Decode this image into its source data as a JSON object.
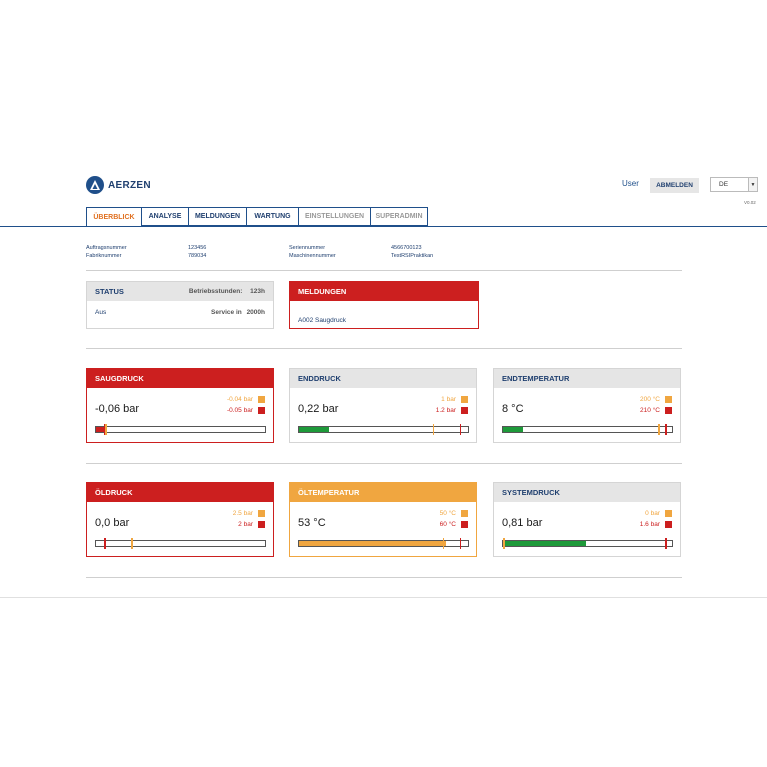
{
  "header": {
    "brand": "AERZEN",
    "user_label": "User",
    "logout_label": "ABMELDEN",
    "language": "DE",
    "version": "V0.02"
  },
  "tabs": [
    {
      "label": "ÜBERBLICK",
      "state": "active"
    },
    {
      "label": "ANALYSE",
      "state": "normal"
    },
    {
      "label": "MELDUNGEN",
      "state": "normal"
    },
    {
      "label": "WARTUNG",
      "state": "normal"
    },
    {
      "label": "EINSTELLUNGEN",
      "state": "disabled"
    },
    {
      "label": "SUPERADMIN",
      "state": "disabled"
    }
  ],
  "info": {
    "auftragsnummer_label": "Auftragsnummer",
    "auftragsnummer_value": "123456",
    "fabriknummer_label": "Fabriknummer",
    "fabriknummer_value": "789034",
    "seriennummer_label": "Seriennummer",
    "seriennummer_value": "4566700123",
    "maschinennummer_label": "Maschinennummer",
    "maschinennummer_value": "TestRSIPraktikan"
  },
  "status": {
    "title": "STATUS",
    "hours_label": "Betriebsstunden:",
    "hours_value": "123h",
    "state": "Aus",
    "service_label": "Service in",
    "service_value": "2000h"
  },
  "meldungen": {
    "title": "MELDUNGEN",
    "message": "A002 Saugdruck"
  },
  "colors": {
    "alarm": "#cc1f1f",
    "warning": "#f0a640",
    "ok": "#1e9a3a",
    "brand": "#1f3f6f"
  },
  "cards": [
    {
      "title": "SAUGDRUCK",
      "value": "-0,06 bar",
      "warn": "-0.04 bar",
      "alarm": "-0.05 bar",
      "state": "alarm",
      "fill": 0.05,
      "warn_pos": 0.055,
      "alarm_pos": 0.045
    },
    {
      "title": "ENDDRUCK",
      "value": "0,22 bar",
      "warn": "1 bar",
      "alarm": "1.2 bar",
      "state": "normal",
      "fill": 0.18,
      "warn_pos": 0.79,
      "alarm_pos": 0.95
    },
    {
      "title": "ENDTEMPERATUR",
      "value": "8 °C",
      "warn": "200 °C",
      "alarm": "210 °C",
      "state": "normal",
      "fill": 0.12,
      "warn_pos": 0.92,
      "alarm_pos": 0.96
    },
    {
      "title": "ÖLDRUCK",
      "value": "0,0 bar",
      "warn": "2.5 bar",
      "alarm": "2 bar",
      "state": "alarm",
      "fill": 0.0,
      "warn_pos": 0.21,
      "alarm_pos": 0.05
    },
    {
      "title": "ÖLTEMPERATUR",
      "value": "53 °C",
      "warn": "50 °C",
      "alarm": "60 °C",
      "state": "warning",
      "fill": 0.87,
      "warn_pos": 0.85,
      "alarm_pos": 0.95
    },
    {
      "title": "SYSTEMDRUCK",
      "value": "0,81 bar",
      "warn": "0 bar",
      "alarm": "1.6 bar",
      "state": "normal",
      "fill": 0.49,
      "warn_pos": 0.0,
      "alarm_pos": 0.96
    }
  ]
}
